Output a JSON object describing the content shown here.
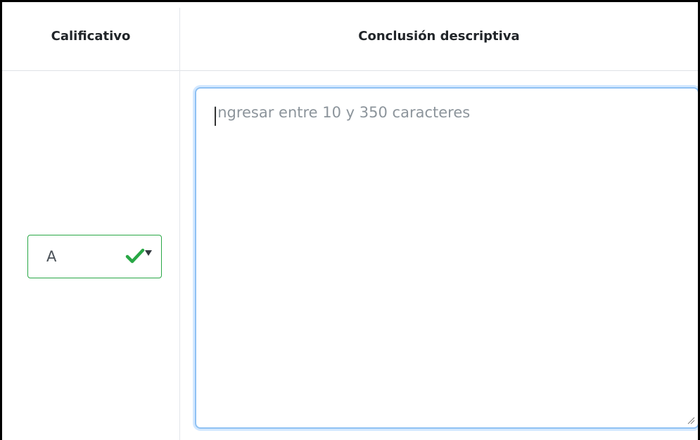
{
  "table": {
    "headers": {
      "calificativo": "Calificativo",
      "conclusion": "Conclusión descriptiva"
    },
    "row": {
      "grade_select": {
        "value": "A",
        "valid": true,
        "status_icon": "check-icon",
        "accent_color": "#28a745"
      },
      "conclusion_field": {
        "value": "",
        "placeholder": "Ingresar entre 10 y 350 caracteres",
        "focus_color": "#80bdff"
      }
    }
  }
}
